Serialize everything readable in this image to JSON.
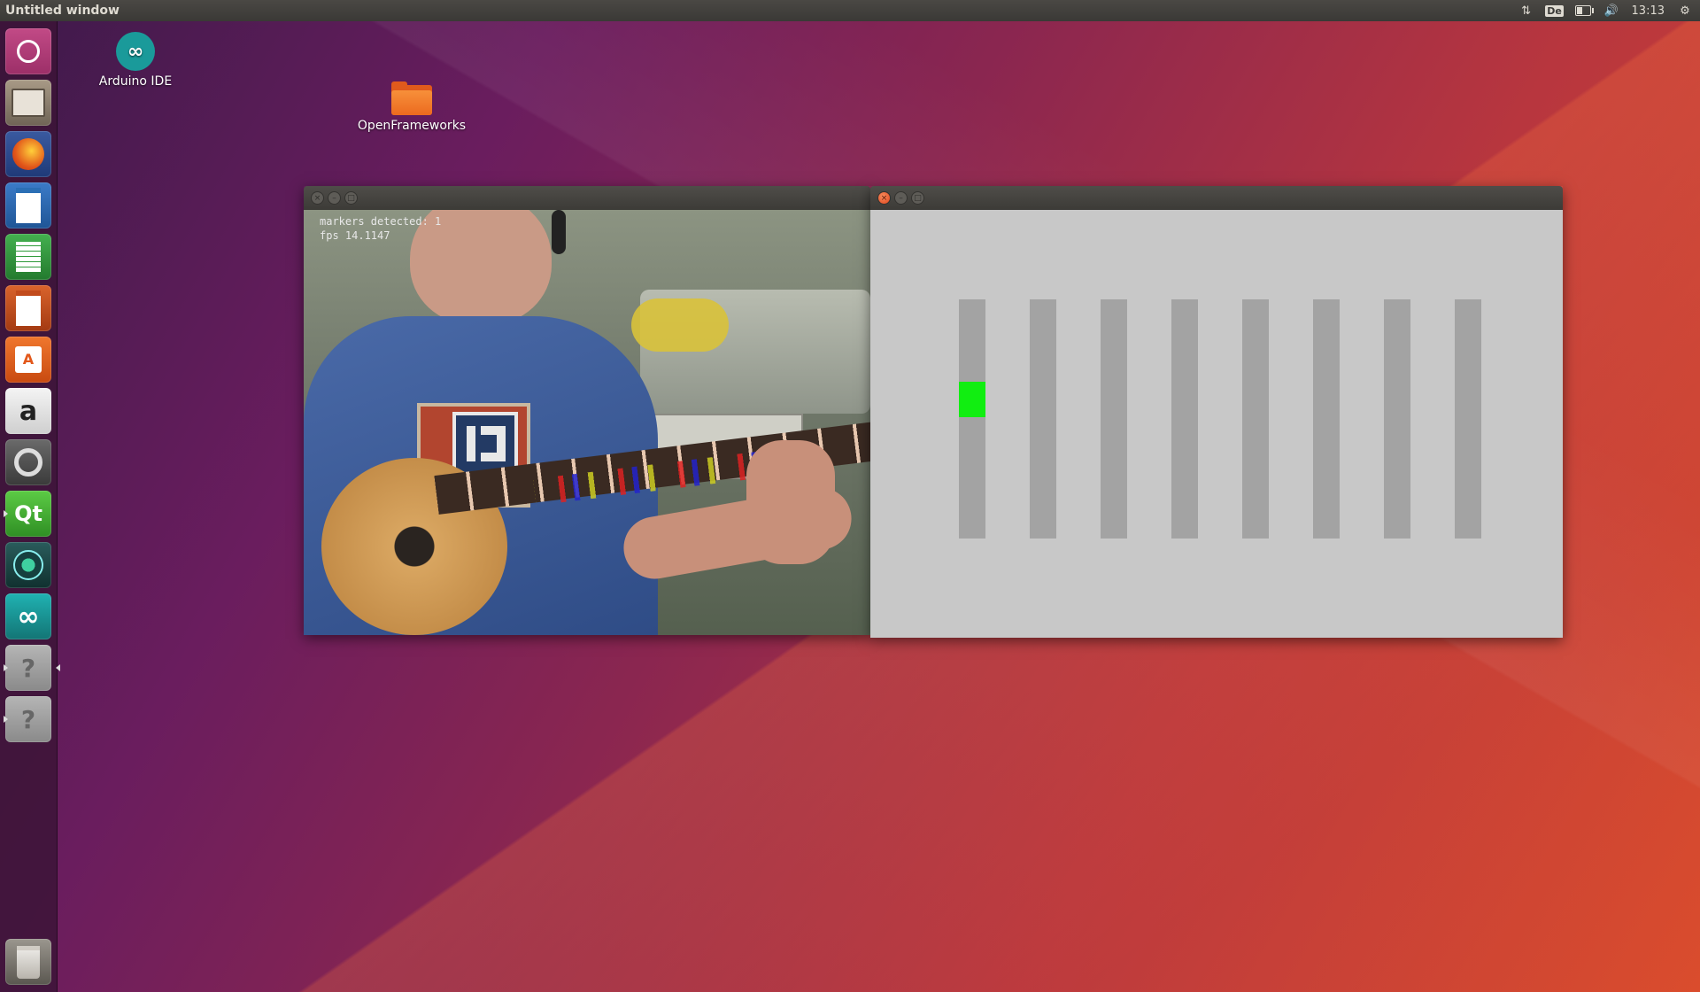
{
  "topbar": {
    "title": "Untitled window",
    "keyboard_layout": "De",
    "clock": "13:13",
    "battery_level": 0.35
  },
  "launcher": {
    "items": [
      {
        "name": "dash-home",
        "icon": "ubuntu-logo-icon",
        "color": "#b43f7a"
      },
      {
        "name": "files",
        "icon": "file-cabinet-icon",
        "color": "#8a7a66"
      },
      {
        "name": "firefox",
        "icon": "firefox-icon",
        "color": "#e36a1f"
      },
      {
        "name": "libreoffice-writer",
        "icon": "writer-icon",
        "color": "#2b6fb5"
      },
      {
        "name": "libreoffice-calc",
        "icon": "calc-icon",
        "color": "#2e9a3a"
      },
      {
        "name": "libreoffice-impress",
        "icon": "impress-icon",
        "color": "#c24b1c"
      },
      {
        "name": "ubuntu-software",
        "icon": "shopping-bag-icon",
        "color": "#e2571a"
      },
      {
        "name": "amazon",
        "icon": "amazon-icon",
        "color": "#e8e8e8"
      },
      {
        "name": "system-settings",
        "icon": "settings-wrench-icon",
        "color": "#c23b2a"
      },
      {
        "name": "qt-creator",
        "icon": "qt-icon",
        "color": "#41b53a"
      },
      {
        "name": "gitkraken",
        "icon": "kraken-icon",
        "color": "#1b4a4a"
      },
      {
        "name": "arduino-ide",
        "icon": "arduino-icon",
        "color": "#1a9a9a"
      },
      {
        "name": "unknown-app-1",
        "icon": "question-icon",
        "color": "#9a9a9a"
      },
      {
        "name": "unknown-app-2",
        "icon": "question-icon",
        "color": "#9a9a9a"
      },
      {
        "name": "trash",
        "icon": "trash-icon",
        "color": "#8c8880"
      }
    ],
    "glyphs": {
      "amazon": "a",
      "qt": "Qt",
      "question": "?",
      "arduino": "∞"
    }
  },
  "desktop": {
    "icons": [
      {
        "label": "Arduino IDE",
        "icon": "arduino-icon"
      },
      {
        "label": "OpenFrameworks",
        "icon": "folder-icon"
      }
    ]
  },
  "camera_window": {
    "overlay_markers": "markers detected: 1",
    "overlay_fps": "fps 14.1147"
  },
  "fret_window": {
    "bar_count": 8,
    "active_bar_index": 0,
    "active_level": 0.42,
    "bar_color": "#a3a3a3",
    "active_color": "#11ee11",
    "background": "#c8c8c8"
  }
}
